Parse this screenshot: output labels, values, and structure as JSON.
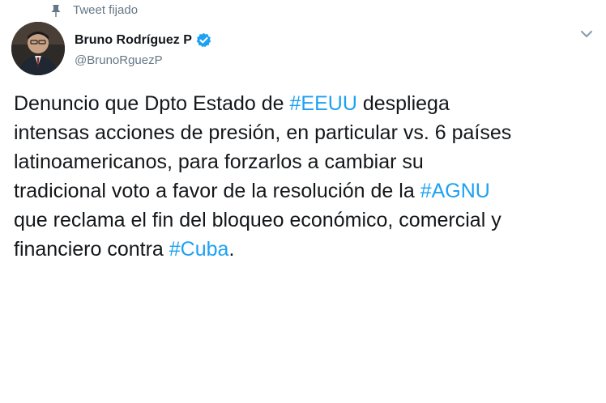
{
  "pinned": {
    "label": "Tweet fijado",
    "icon": "pin-icon"
  },
  "author": {
    "name": "Bruno Rodríguez P",
    "handle": "@BrunoRguezP",
    "verified_icon": "verified-badge-icon",
    "avatar_icon": "avatar"
  },
  "menu_icon": "chevron-down-icon",
  "tweet": {
    "lines": [
      [
        {
          "t": "Denuncio que Dpto Estado de "
        },
        {
          "h": "#EEUU"
        },
        {
          "t": " despliega"
        }
      ],
      [
        {
          "t": "intensas acciones de presión, en particular vs. 6 países"
        }
      ],
      [
        {
          "t": "latinoamericanos, para forzarlos a cambiar su"
        }
      ],
      [
        {
          "t": "tradicional voto a favor de la resolución de la "
        },
        {
          "h": "#AGNU"
        }
      ],
      [
        {
          "t": "que reclama el fin del bloqueo económico, comercial y"
        }
      ],
      [
        {
          "t": "financiero contra "
        },
        {
          "h": "#Cuba"
        },
        {
          "t": "."
        }
      ]
    ]
  },
  "colors": {
    "link": "#1da1f2",
    "text": "#14171a",
    "muted": "#657786",
    "verified": "#1da1f2"
  }
}
